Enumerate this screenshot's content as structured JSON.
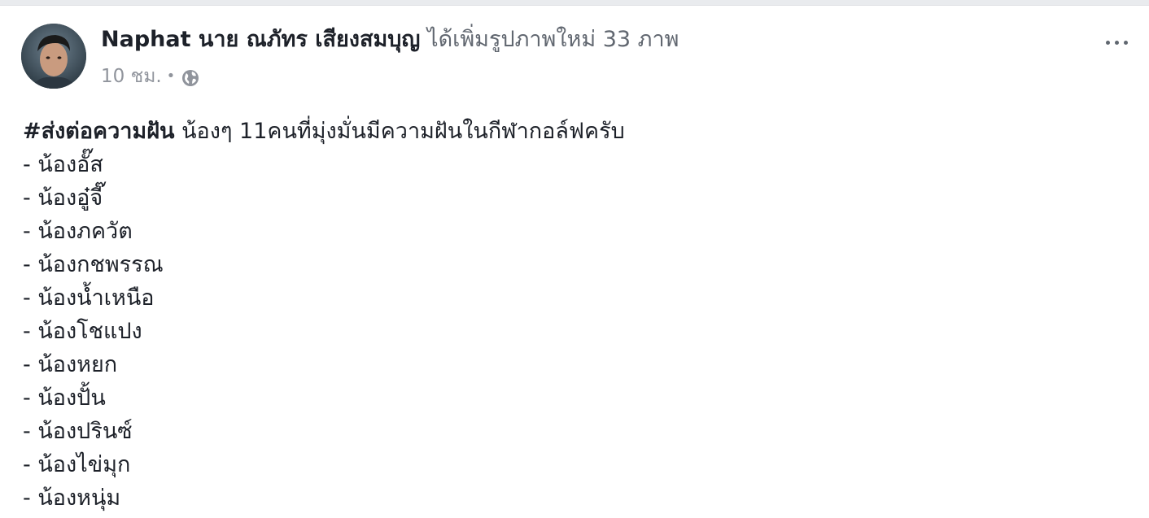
{
  "post": {
    "author": "Naphat นาย ณภัทร เสียงสมบุญ",
    "action": "ได้เพิ่มรูปภาพใหม่ 33 ภาพ",
    "time": "10 ชม.",
    "separator": "•",
    "privacy_icon": "globe-icon",
    "more_icon": "ellipsis-icon",
    "hashtag": "#ส่งต่อความฝัน",
    "intro": " น้องๆ 11คนที่มุ่งมั่นมีความฝันในกีฬากอล์ฟครับ",
    "list": [
      "- น้องอั๊ส",
      "- น้องอู๋จี๊",
      "- น้องภควัต",
      "- น้องกชพรรณ",
      "- น้องน้ำเหนือ",
      "- น้องโชแปง",
      "- น้องหยก",
      "- น้องปั้น",
      "- น้องปรินซ์",
      "- น้องไข่มุก",
      "- น้องหนุ่ม"
    ]
  }
}
